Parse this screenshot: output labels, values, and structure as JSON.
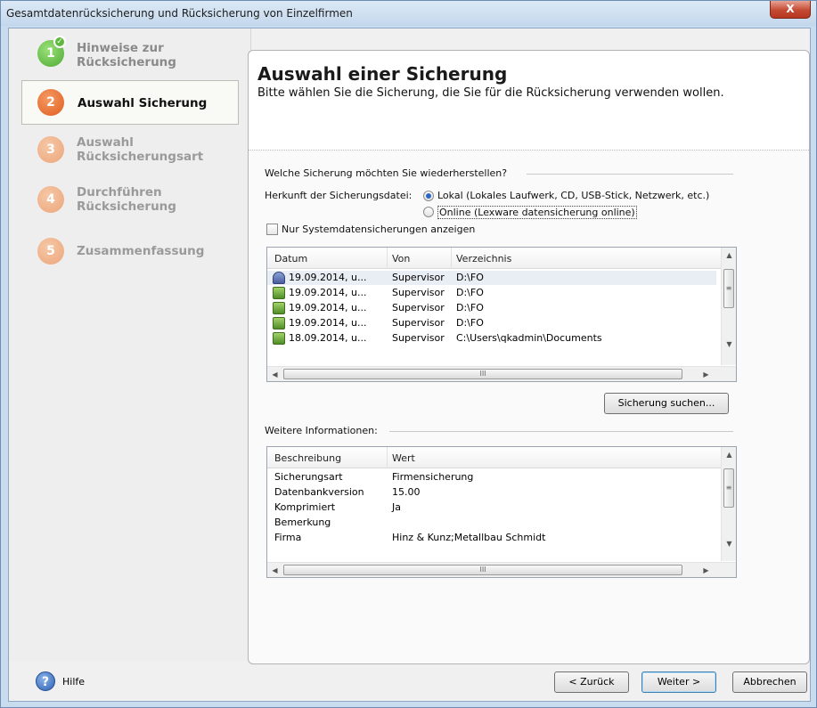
{
  "window": {
    "title": "Gesamtdatenrücksicherung und Rücksicherung von Einzelfirmen",
    "close_label": "X"
  },
  "steps": [
    {
      "number": "1",
      "label_line1": "Hinweise zur",
      "label_line2": "Rücksicherung",
      "state": "done"
    },
    {
      "number": "2",
      "label_line1": "Auswahl Sicherung",
      "label_line2": "",
      "state": "active"
    },
    {
      "number": "3",
      "label_line1": "Auswahl",
      "label_line2": "Rücksicherungsart",
      "state": "todo"
    },
    {
      "number": "4",
      "label_line1": "Durchführen",
      "label_line2": "Rücksicherung",
      "state": "todo"
    },
    {
      "number": "5",
      "label_line1": "Zusammenfassung",
      "label_line2": "",
      "state": "todo"
    }
  ],
  "header": {
    "title": "Auswahl einer Sicherung",
    "subtitle": "Bitte wählen Sie die Sicherung, die Sie für die Rücksicherung verwenden wollen."
  },
  "selection": {
    "question": "Welche Sicherung möchten Sie wiederherstellen?",
    "source_label": "Herkunft der Sicherungsdatei:",
    "option_local": "Lokal (Lokales Laufwerk, CD, USB-Stick, Netzwerk, etc.)",
    "option_online": "Online (Lexware datensicherung online)",
    "selected_option": "local",
    "checkbox_label": "Nur Systemdatensicherungen anzeigen",
    "checkbox_checked": false
  },
  "backups": {
    "columns": [
      "Datum",
      "Von",
      "Verzeichnis"
    ],
    "rows": [
      {
        "datum": "19.09.2014, u...",
        "von": "Supervisor",
        "verzeichnis": "D:\\FO",
        "icon": "system-backup-icon",
        "selected": true
      },
      {
        "datum": "19.09.2014, u...",
        "von": "Supervisor",
        "verzeichnis": "D:\\FO",
        "icon": "company-backup-icon",
        "selected": false
      },
      {
        "datum": "19.09.2014, u...",
        "von": "Supervisor",
        "verzeichnis": "D:\\FO",
        "icon": "company-backup-icon",
        "selected": false
      },
      {
        "datum": "19.09.2014, u...",
        "von": "Supervisor",
        "verzeichnis": "D:\\FO",
        "icon": "company-backup-icon",
        "selected": false
      },
      {
        "datum": "18.09.2014, u...",
        "von": "Supervisor",
        "verzeichnis": "C:\\Users\\qkadmin\\Documents",
        "icon": "company-backup-icon",
        "selected": false
      }
    ],
    "search_button": "Sicherung suchen..."
  },
  "details": {
    "section_label": "Weitere Informationen:",
    "columns": [
      "Beschreibung",
      "Wert"
    ],
    "rows": [
      {
        "key": "Sicherungsart",
        "value": "Firmensicherung"
      },
      {
        "key": "Datenbankversion",
        "value": "15.00"
      },
      {
        "key": "Komprimiert",
        "value": "Ja"
      },
      {
        "key": "Bemerkung",
        "value": ""
      },
      {
        "key": "Firma",
        "value": "Hinz & Kunz;Metallbau Schmidt"
      }
    ]
  },
  "footer": {
    "help_label": "Hilfe",
    "back_label": "< Zurück",
    "next_label": "Weiter >",
    "cancel_label": "Abbrechen"
  },
  "scroll_glyphs": {
    "up": "▲",
    "down": "▼",
    "left": "◀",
    "right": "▶",
    "grip": "≡",
    "hgrip": "III"
  }
}
